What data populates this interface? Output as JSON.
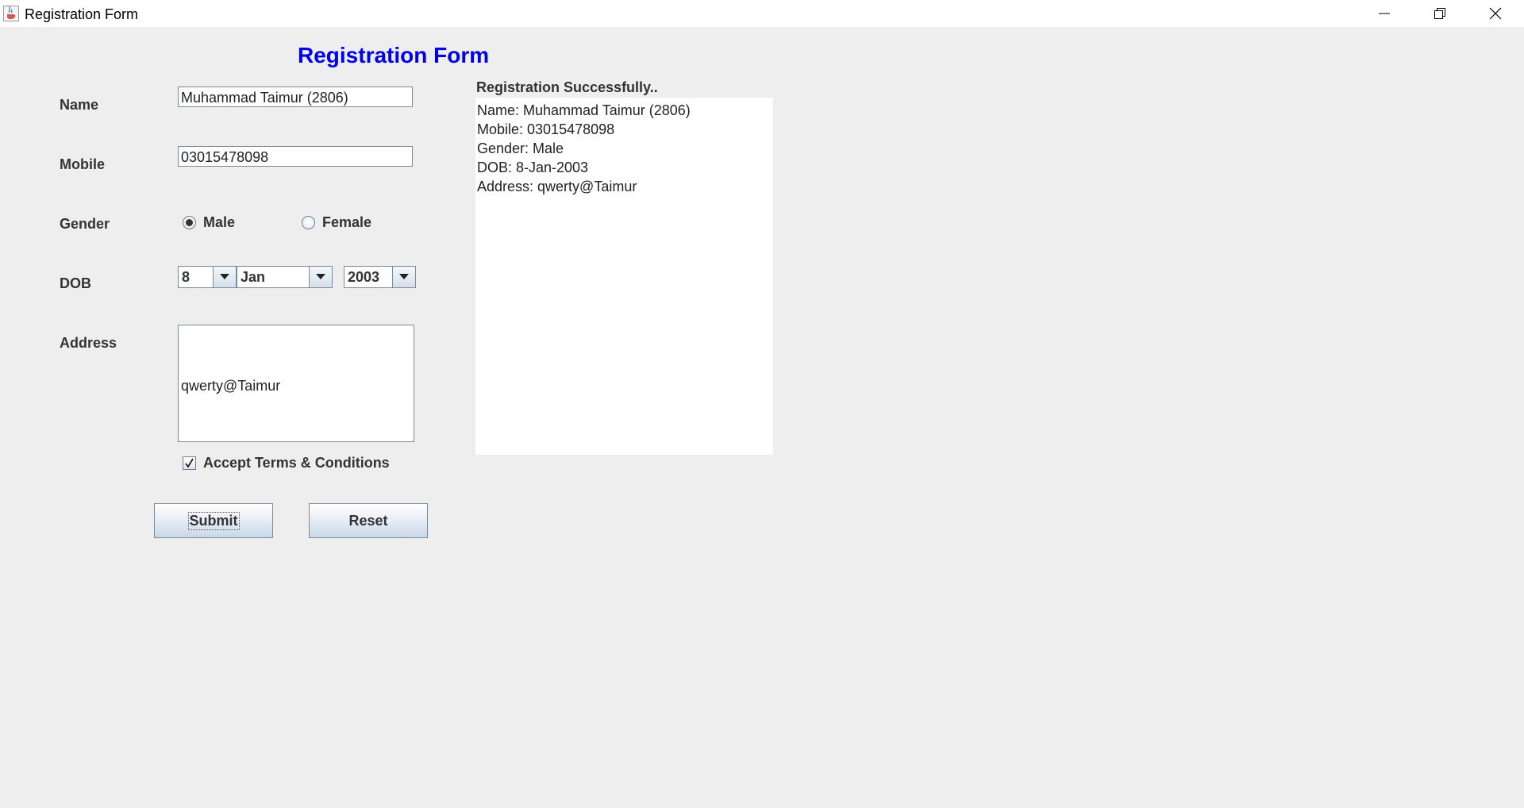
{
  "window": {
    "title": "Registration Form",
    "icon": "java-cup-icon"
  },
  "form": {
    "heading": "Registration Form",
    "heading_color": "#0000ee",
    "name_label": "Name",
    "name_value": "Muhammad Taimur (2806)",
    "mobile_label": "Mobile",
    "mobile_value": "03015478098",
    "gender_label": "Gender",
    "gender_options": [
      "Male",
      "Female"
    ],
    "gender_selected": "Male",
    "dob_label": "DOB",
    "dob_day": "8",
    "dob_month": "Jan",
    "dob_year": "2003",
    "address_label": "Address",
    "address_value": "qwerty@Taimur",
    "terms_label": "Accept Terms & Conditions",
    "terms_checked": true,
    "submit_label": "Submit",
    "reset_label": "Reset"
  },
  "result": {
    "heading": "Registration Successfully..",
    "lines": [
      "Name: Muhammad Taimur (2806)",
      "Mobile: 03015478098",
      "Gender: Male",
      "DOB: 8-Jan-2003",
      "Address: qwerty@Taimur"
    ]
  }
}
